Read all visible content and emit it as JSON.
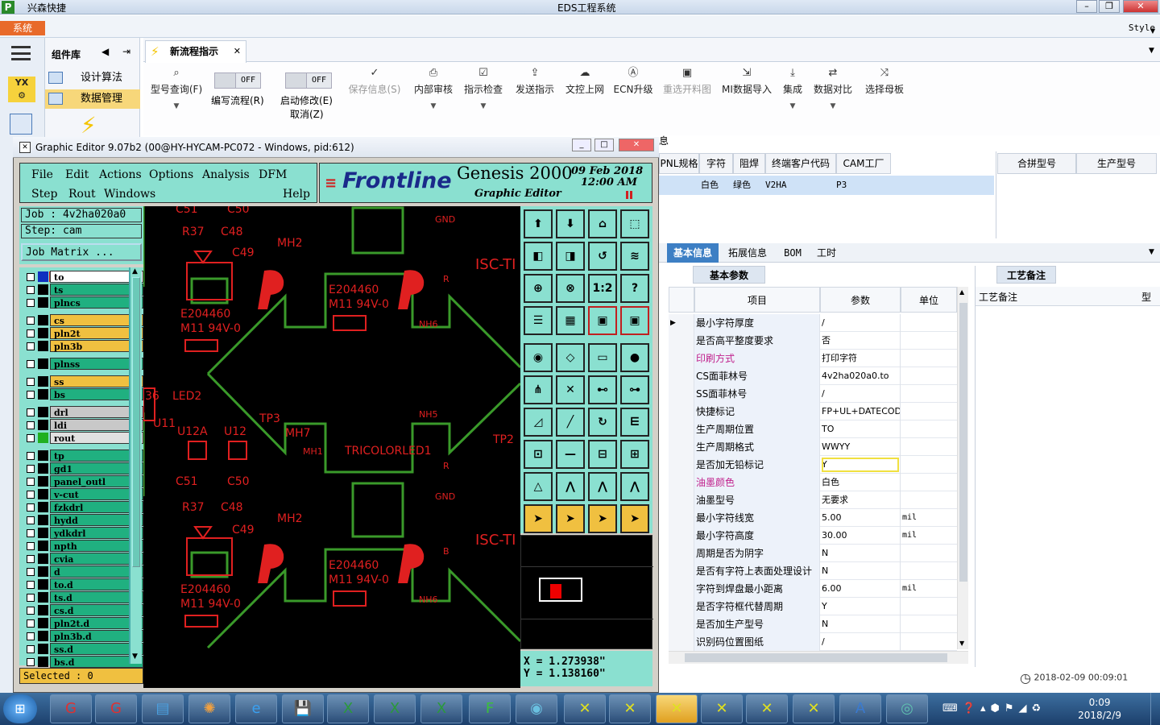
{
  "window": {
    "app_name": "兴森快捷",
    "title": "EDS工程系统"
  },
  "menubar": {
    "system": "系统",
    "style": "Style"
  },
  "leftpanel": {
    "header": "组件库",
    "items": [
      "设计算法",
      "数据管理"
    ]
  },
  "tab": {
    "label": "新流程指示"
  },
  "ribbon": {
    "query": "型号查询(F)",
    "edit_flow": "编写流程(R)",
    "edit_flow_toggle": "OFF",
    "start_modify": "启动修改(E)",
    "start_modify_toggle": "OFF",
    "cancel": "取消(Z)",
    "save": "保存信息(S)",
    "review": "内部审核",
    "check": "指示检查",
    "send": "发送指示",
    "upload": "文控上网",
    "ecn": "ECN升级",
    "reselect": "重选开料图",
    "mi_import": "MI数据导入",
    "integrate": "集成",
    "compare": "数据对比",
    "select_board": "选择母板"
  },
  "grid1": {
    "info_label": "息",
    "headers": [
      "PNL规格",
      "字符",
      "阻焊",
      "终端客户代码",
      "CAM工厂"
    ],
    "right_headers": [
      "合拼型号",
      "生产型号"
    ],
    "row": [
      "白色",
      "绿色",
      "V2HA",
      "P3"
    ]
  },
  "tabs2": [
    "基本信息",
    "拓展信息",
    "BOM",
    "工时"
  ],
  "basic_tab": "基本参数",
  "notes_tab": "工艺备注",
  "notes_header": "工艺备注",
  "notes_header2": "型",
  "param_headers": [
    "项目",
    "参数",
    "单位"
  ],
  "params": [
    {
      "item": "最小字符厚度",
      "value": "/",
      "unit": ""
    },
    {
      "item": "是否高平整度要求",
      "value": "否",
      "unit": ""
    },
    {
      "item": "印刷方式",
      "value": "打印字符",
      "unit": ""
    },
    {
      "item": "CS面菲林号",
      "value": "4v2ha020a0.to",
      "unit": ""
    },
    {
      "item": "SS面菲林号",
      "value": "/",
      "unit": ""
    },
    {
      "item": "快捷标记",
      "value": "FP+UL+DATECODE",
      "unit": ""
    },
    {
      "item": "生产周期位置",
      "value": "TO",
      "unit": ""
    },
    {
      "item": "生产周期格式",
      "value": "WWYY",
      "unit": ""
    },
    {
      "item": "是否加无铅标记",
      "value": "Y",
      "unit": ""
    },
    {
      "item": "油墨颜色",
      "value": "白色",
      "unit": ""
    },
    {
      "item": "油墨型号",
      "value": "无要求",
      "unit": ""
    },
    {
      "item": "最小字符线宽",
      "value": "5.00",
      "unit": "mil"
    },
    {
      "item": "最小字符高度",
      "value": "30.00",
      "unit": "mil"
    },
    {
      "item": "周期是否为阴字",
      "value": "N",
      "unit": ""
    },
    {
      "item": "是否有字符上表面处理设计",
      "value": "N",
      "unit": ""
    },
    {
      "item": "字符到焊盘最小距离",
      "value": "6.00",
      "unit": "mil"
    },
    {
      "item": "是否字符框代替周期",
      "value": "Y",
      "unit": ""
    },
    {
      "item": "是否加生产型号",
      "value": "N",
      "unit": ""
    },
    {
      "item": "识别码位置图纸",
      "value": "/",
      "unit": ""
    }
  ],
  "datetime": "2018-02-09 00:09:01",
  "genesis": {
    "title": "Graphic Editor 9.07b2 (00@HY-HYCAM-PC072 - Windows, pid:612)",
    "menu": [
      "File",
      "Edit",
      "Actions",
      "Options",
      "Analysis",
      "DFM",
      "Step",
      "Rout",
      "Windows",
      "Help"
    ],
    "brand": "Frontline",
    "product": "Genesis 2000",
    "subtitle": "Graphic Editor",
    "date": "09 Feb 2018",
    "time": "12:00 AM",
    "job": "Job : 4v2ha020a0",
    "step": "Step: cam",
    "job_matrix": "Job Matrix ...",
    "selected": "Selected : 0",
    "x_coord": "X = 1.273938\"",
    "y_coord": "Y = 1.138160\"",
    "layers": [
      {
        "name": "to",
        "color": "#ffffff"
      },
      {
        "name": "ts",
        "color": "#20b080"
      },
      {
        "name": "plncs",
        "color": "#20b080"
      },
      {
        "name": "cs",
        "color": "#f0c040"
      },
      {
        "name": "pln2t",
        "color": "#f0c040"
      },
      {
        "name": "pln3b",
        "color": "#f0c040"
      },
      {
        "name": "plnss",
        "color": "#20b080"
      },
      {
        "name": "ss",
        "color": "#f0c040"
      },
      {
        "name": "bs",
        "color": "#20b080"
      },
      {
        "name": "drl",
        "color": "#c8c8c8"
      },
      {
        "name": "ldi",
        "color": "#c8c8c8"
      },
      {
        "name": "rout",
        "color": "#e0e0e0"
      },
      {
        "name": "tp",
        "color": "#20b080"
      },
      {
        "name": "gd1",
        "color": "#20b080"
      },
      {
        "name": "panel_outl",
        "color": "#20b080"
      },
      {
        "name": "v-cut",
        "color": "#20b080"
      },
      {
        "name": "fzkdrl",
        "color": "#20b080"
      },
      {
        "name": "hydd",
        "color": "#20b080"
      },
      {
        "name": "ydkdrl",
        "color": "#20b080"
      },
      {
        "name": "npth",
        "color": "#20b080"
      },
      {
        "name": "cvia",
        "color": "#20b080"
      },
      {
        "name": "d",
        "color": "#20b080"
      },
      {
        "name": "to.d",
        "color": "#20b080"
      },
      {
        "name": "ts.d",
        "color": "#20b080"
      },
      {
        "name": "cs.d",
        "color": "#20b080"
      },
      {
        "name": "pln2t.d",
        "color": "#20b080"
      },
      {
        "name": "pln3b.d",
        "color": "#20b080"
      },
      {
        "name": "ss.d",
        "color": "#20b080"
      },
      {
        "name": "bs.d",
        "color": "#20b080"
      }
    ],
    "pcb_labels": {
      "c51": "C51",
      "c50": "C50",
      "r37": "R37",
      "c48": "C48",
      "c49": "C49",
      "mh2": "MH2",
      "gnd": "GND",
      "isc": "ISC-TI",
      "e2044": "E204460",
      "m11": "M11 94V-0",
      "nh6": "NH6",
      "nh5": "NH5",
      "led2": "LED2",
      "u11": "U11",
      "u12a": "U12A",
      "u12": "U12",
      "tp3": "TP3",
      "mh7": "MH7",
      "mh1": "MH1",
      "tricolor": "TRICOLORLED1",
      "tp2": "TP2",
      "r": "R",
      "b": "B",
      "n36": "36"
    }
  },
  "taskbar": {
    "time": "0:09",
    "date": "2018/2/9"
  }
}
